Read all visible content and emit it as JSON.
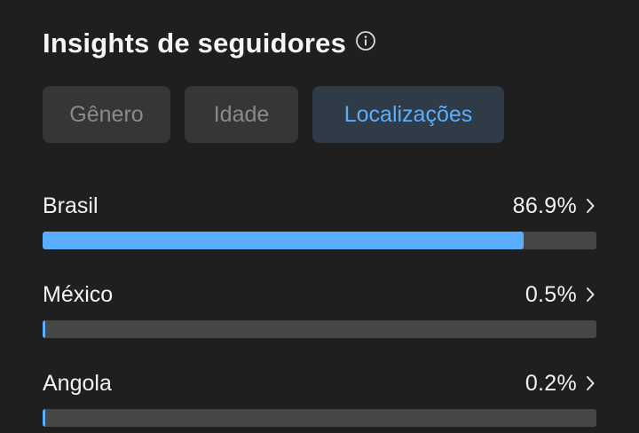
{
  "header": {
    "title": "Insights de seguidores",
    "info_icon": "info-circle-icon"
  },
  "tabs": [
    {
      "label": "Gênero",
      "active": false
    },
    {
      "label": "Idade",
      "active": false
    },
    {
      "label": "Localizações",
      "active": true
    }
  ],
  "locations": [
    {
      "label": "Brasil",
      "value": "86.9%",
      "fraction": 0.869
    },
    {
      "label": "México",
      "value": "0.5%",
      "fraction": 0.005
    },
    {
      "label": "Angola",
      "value": "0.2%",
      "fraction": 0.002
    }
  ],
  "colors": {
    "background": "#1f1f1f",
    "accent": "#5aaeff",
    "track": "#474747",
    "tab_inactive_bg": "#363636",
    "tab_active_bg": "#2f3b47"
  }
}
